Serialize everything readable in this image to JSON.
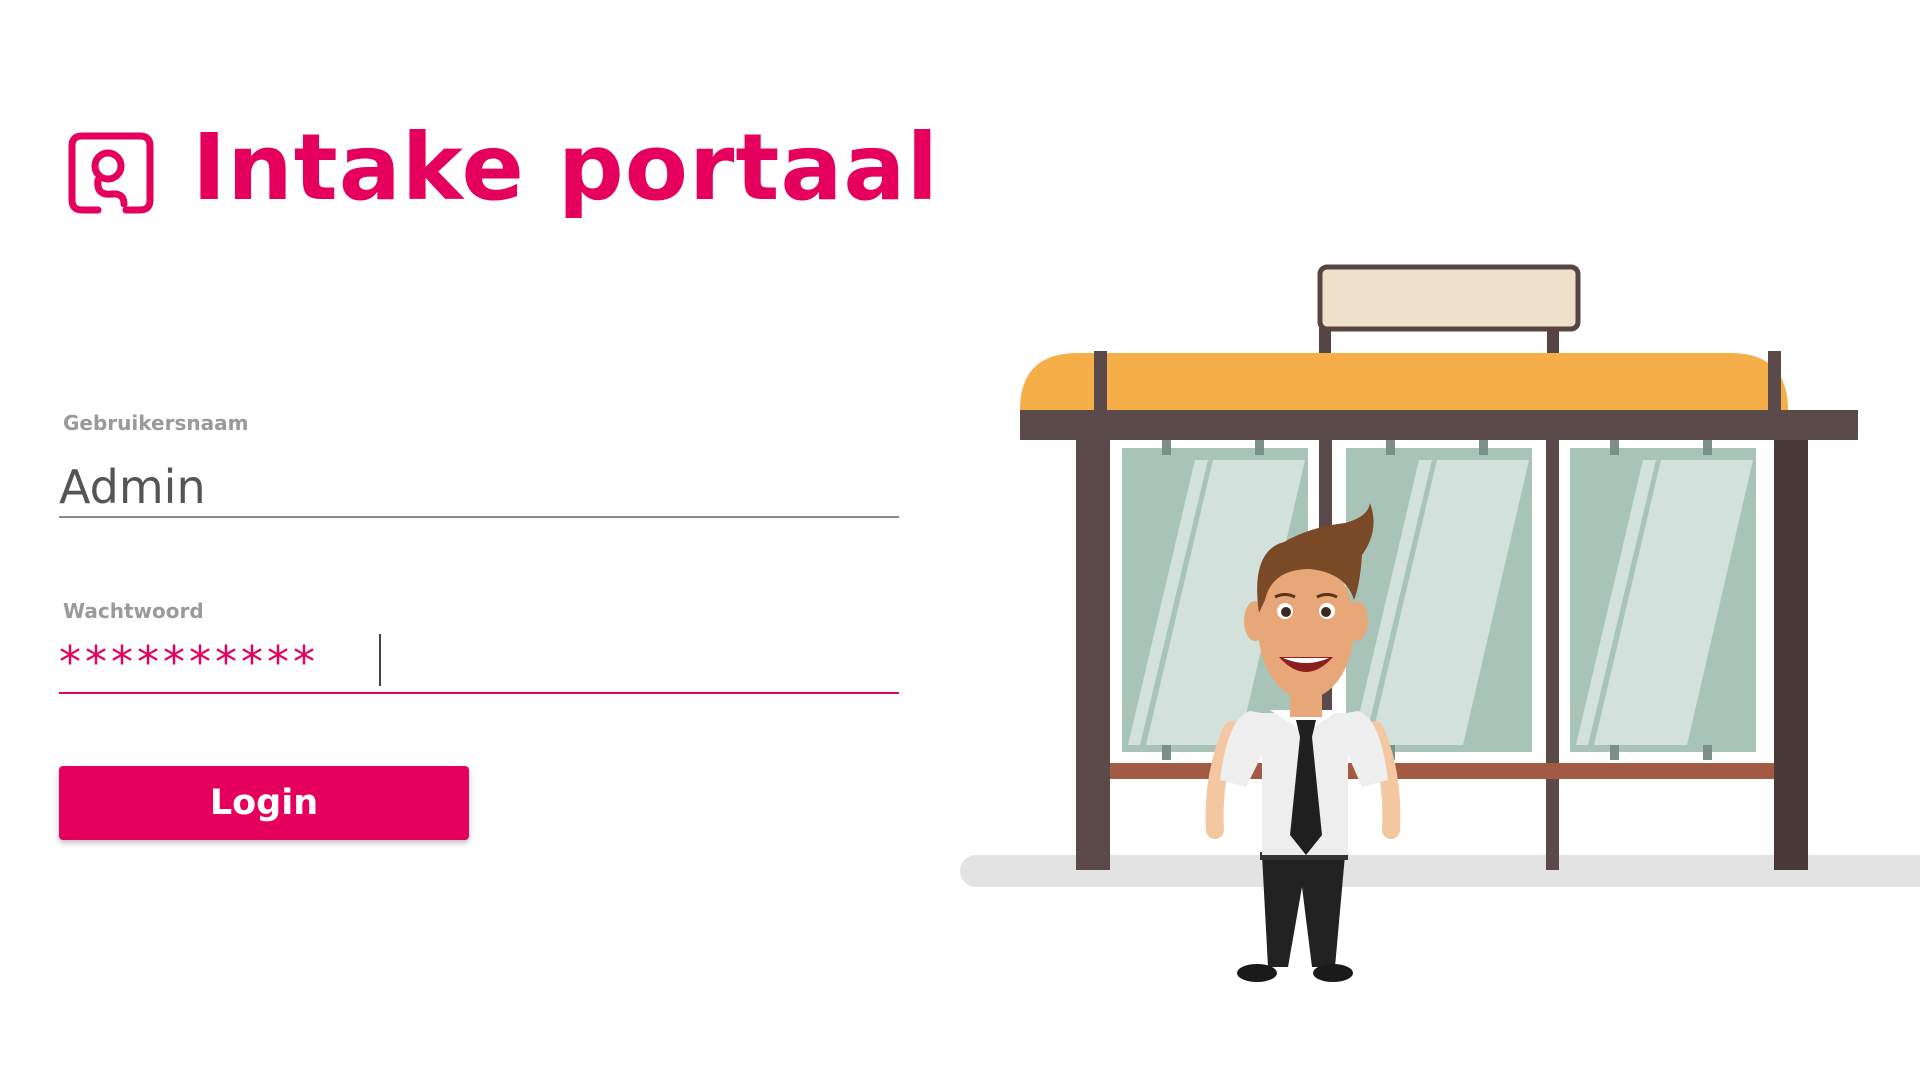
{
  "app": {
    "title": "Intake portaal"
  },
  "login_form": {
    "username_label": "Gebruikersnaam",
    "username_value": "Admin",
    "password_label": "Wachtwoord",
    "password_value": "**********",
    "submit_label": "Login"
  },
  "icons": {
    "logo": "intake-logo-icon",
    "illustration": "bus-stop-businessman-illustration"
  },
  "colors": {
    "brand": "#e5005e",
    "label_gray": "#9a9a9a",
    "value_gray": "#555555",
    "shelter_roof": "#f5ae48",
    "shelter_frame": "#5b4a4a",
    "glass": "#a8c4b9"
  }
}
